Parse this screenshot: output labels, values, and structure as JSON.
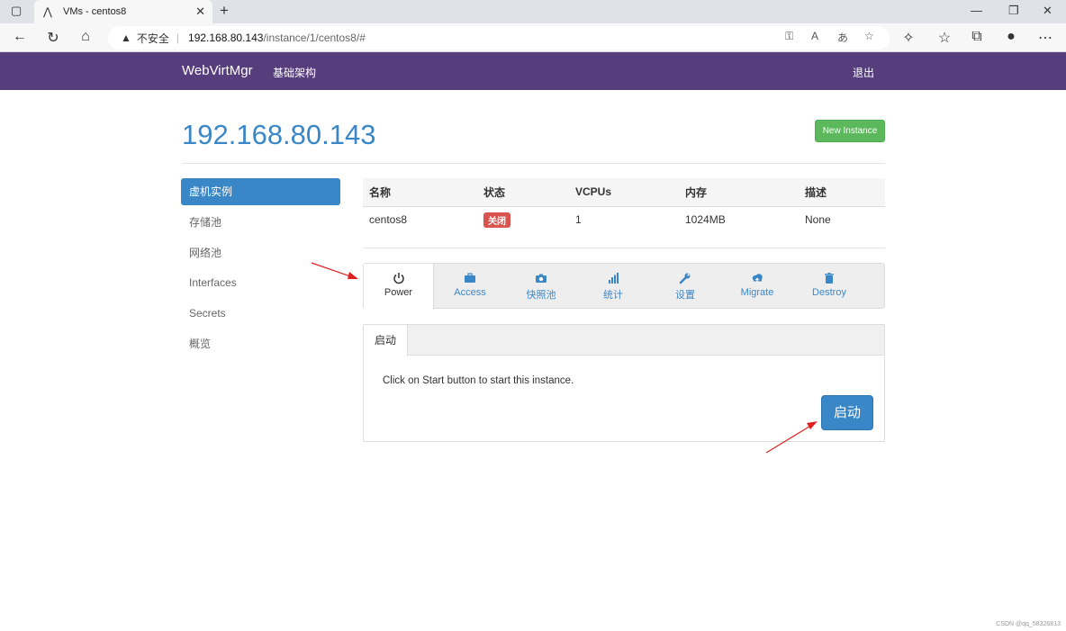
{
  "browser": {
    "tab_title": "VMs - centos8",
    "insecure_label": "不安全",
    "url_host": "192.168.80.143",
    "url_path": "/instance/1/centos8/#"
  },
  "navbar": {
    "brand": "WebVirtMgr",
    "infrastructure": "基础架构",
    "logout": "退出"
  },
  "page": {
    "title": "192.168.80.143",
    "new_instance": "New Instance"
  },
  "sidebar": {
    "items": [
      {
        "label": "虚机实例",
        "active": true
      },
      {
        "label": "存储池"
      },
      {
        "label": "网络池"
      },
      {
        "label": "Interfaces"
      },
      {
        "label": "Secrets"
      },
      {
        "label": "概览"
      }
    ]
  },
  "table": {
    "headers": [
      "名称",
      "状态",
      "VCPUs",
      "内存",
      "描述"
    ],
    "row": {
      "name": "centos8",
      "status": "关闭",
      "vcpus": "1",
      "memory": "1024MB",
      "description": "None"
    }
  },
  "tabs": [
    {
      "label": "Power",
      "icon": "power-icon"
    },
    {
      "label": "Access",
      "icon": "briefcase-icon"
    },
    {
      "label": "快照池",
      "icon": "camera-icon"
    },
    {
      "label": "统计",
      "icon": "signal-bars-icon"
    },
    {
      "label": "设置",
      "icon": "wrench-icon"
    },
    {
      "label": "Migrate",
      "icon": "cloud-upload-icon"
    },
    {
      "label": "Destroy",
      "icon": "trash-icon"
    }
  ],
  "power_panel": {
    "subtab": "启动",
    "message": "Click on Start button to start this instance.",
    "start_button": "启动"
  },
  "watermark": "CSDN @qq_58326813",
  "colors": {
    "navbar": "#563d7c",
    "primary": "#3a87c8",
    "success": "#5cb85c",
    "danger": "#d9534f",
    "annotation": "#e02020"
  }
}
